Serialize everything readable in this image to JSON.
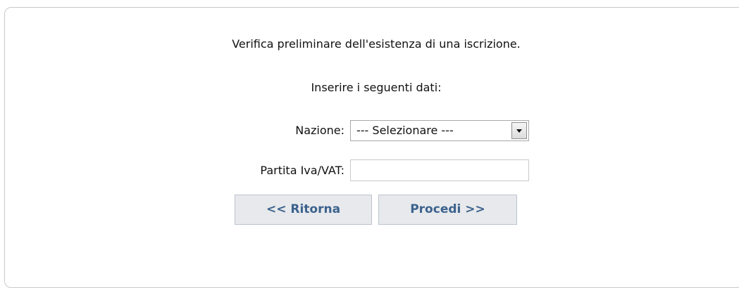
{
  "form": {
    "intro_text": "Verifica preliminare dell'esistenza di una iscrizione.",
    "subtitle": "Inserire i seguenti dati:",
    "nazione_label": "Nazione:",
    "nazione_selected": "--- Selezionare ---",
    "partita_iva_label": "Partita Iva/VAT:",
    "partita_iva_value": ""
  },
  "buttons": {
    "back_label": "<< Ritorna",
    "next_label": "Procedi >>"
  },
  "icons": {
    "dropdown": "chevron-down-icon"
  }
}
